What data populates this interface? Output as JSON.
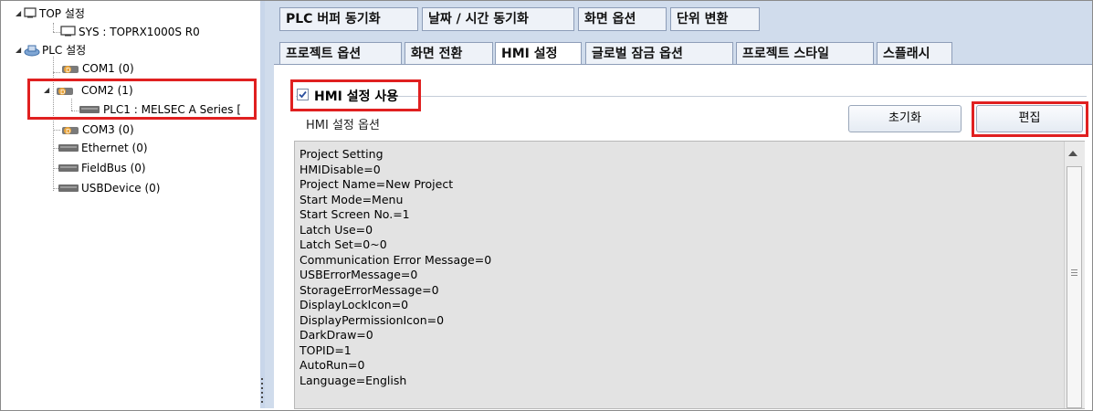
{
  "tree": {
    "top_label": "TOP 설정",
    "sys_label": "SYS : TOPRX1000S R0",
    "plc_label": "PLC 설정",
    "com1_label": "COM1 (0)",
    "com2_label": "COM2 (1)",
    "plc1_label": "PLC1 : MELSEC A Series [",
    "com3_label": "COM3 (0)",
    "ethernet_label": "Ethernet (0)",
    "fieldbus_label": "FieldBus (0)",
    "usbdevice_label": "USBDevice (0)"
  },
  "tabs_row1": [
    "PLC 버퍼 동기화",
    "날짜 / 시간 동기화",
    "화면 옵션",
    "단위 변환"
  ],
  "tabs_row2": [
    "프로젝트 옵션",
    "화면 전환",
    "HMI 설정",
    "글로벌 잠금 옵션",
    "프로젝트 스타일",
    "스플래시"
  ],
  "active_tab": "HMI 설정",
  "hmi": {
    "enable_label": "HMI 설정 사용",
    "enabled": true,
    "options_label": "HMI 설정 옵션",
    "reset_button": "초기화",
    "edit_button": "편집"
  },
  "settings_text": [
    "Project Setting",
    "HMIDisable=0",
    "Project Name=New Project",
    "Start Mode=Menu",
    "Start Screen No.=1",
    "Latch Use=0",
    "Latch Set=0~0",
    "Communication Error Message=0",
    "USBErrorMessage=0",
    "StorageErrorMessage=0",
    "DisplayLockIcon=0",
    "DisplayPermissionIcon=0",
    "DarkDraw=0",
    "TOPID=1",
    "AutoRun=0",
    "Language=English"
  ],
  "colors": {
    "highlight": "#e02020",
    "panel_bg": "#d0dcec",
    "textbox_bg": "#e3e3e3"
  }
}
